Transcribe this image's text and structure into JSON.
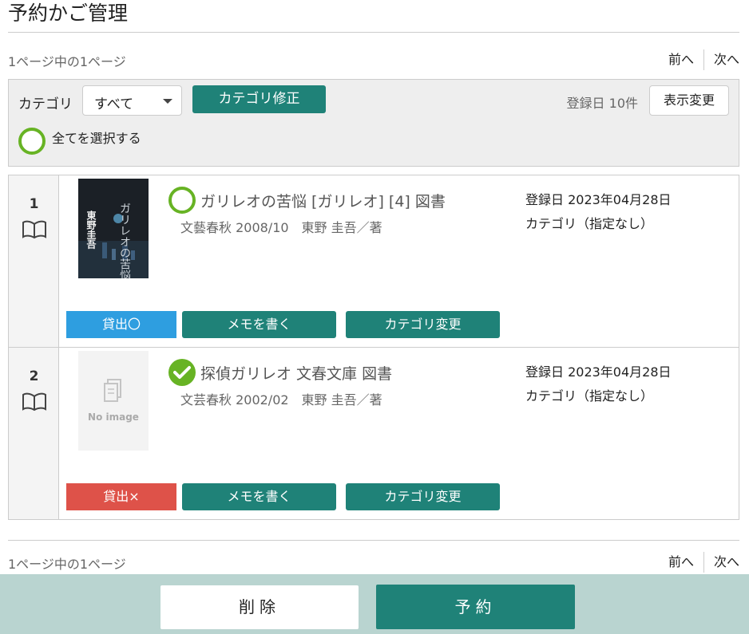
{
  "page": {
    "title": "予約かご管理"
  },
  "pager": {
    "count_text": "1ページ中の1ページ",
    "prev": "前へ",
    "next": "次へ"
  },
  "filter": {
    "category_label": "カテゴリ",
    "category_selected": "すべて",
    "category_fix_button": "カテゴリ修正",
    "sort_text": "登録日 10件",
    "display_change_button": "表示変更",
    "select_all_label": "全てを選択する"
  },
  "items": [
    {
      "number": "1",
      "cover": "ガリレオの苦悩",
      "cover_author": "東野圭吾",
      "title": "ガリレオの苦悩 [ガリレオ] [4] 図書",
      "meta": "文藝春秋 2008/10　東野 圭吾／著",
      "registered": "登録日 2023年04月28日",
      "category": "カテゴリ（指定なし）",
      "status_label": "貸出〇",
      "selected": false,
      "memo_button": "メモを書く",
      "category_change_button": "カテゴリ変更"
    },
    {
      "number": "2",
      "cover_placeholder": "No image",
      "title": "探偵ガリレオ 文春文庫 図書",
      "meta": "文芸春秋 2002/02　東野 圭吾／著",
      "registered": "登録日 2023年04月28日",
      "category": "カテゴリ（指定なし）",
      "status_label": "貸出×",
      "selected": true,
      "memo_button": "メモを書く",
      "category_change_button": "カテゴリ変更"
    }
  ],
  "footer": {
    "delete_button": "削除",
    "reserve_button": "予約"
  },
  "colors": {
    "teal": "#1f8278",
    "green": "#67b324",
    "available": "#2e9ee0",
    "unavailable": "#de5249",
    "footer_bg": "#b9d4d0"
  }
}
